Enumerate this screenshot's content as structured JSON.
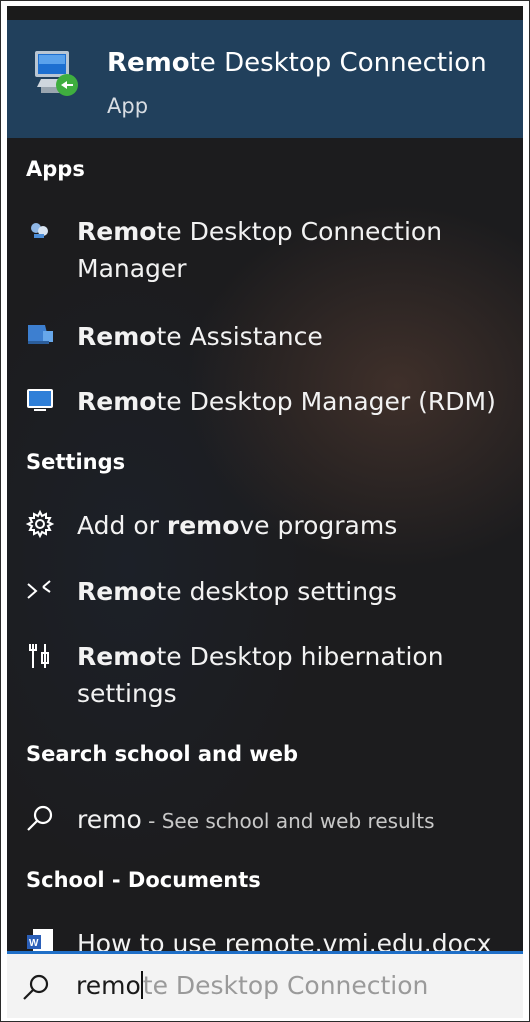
{
  "best_match": {
    "title_bold": "Remo",
    "title_rest": "te Desktop Connection",
    "subtitle": "App"
  },
  "sections": {
    "apps": "Apps",
    "settings": "Settings",
    "web": "Search school and web",
    "docs": "School - Documents"
  },
  "apps": [
    {
      "bold": "Remo",
      "rest": "te Desktop Connection",
      "line2": "Manager"
    },
    {
      "bold": "Remo",
      "rest": "te Assistance"
    },
    {
      "bold": "Remo",
      "rest": "te Desktop Manager (RDM)"
    }
  ],
  "settings": [
    {
      "pre": "Add or ",
      "bold": "remo",
      "rest": "ve programs"
    },
    {
      "bold": "Remo",
      "rest": "te desktop settings"
    },
    {
      "bold": "Remo",
      "rest": "te Desktop hibernation",
      "line2": "settings"
    }
  ],
  "web": {
    "query": "remo",
    "hint": " - See school and web results"
  },
  "docs": [
    {
      "name": "How to use remote.vmi.edu.docx"
    }
  ],
  "search": {
    "typed": "remo",
    "suggestion": "te Desktop Connection"
  },
  "colors": {
    "best_match_bg": "#21405c",
    "panel_bg": "#1c1c1e",
    "search_accent": "#1f6fc7"
  }
}
